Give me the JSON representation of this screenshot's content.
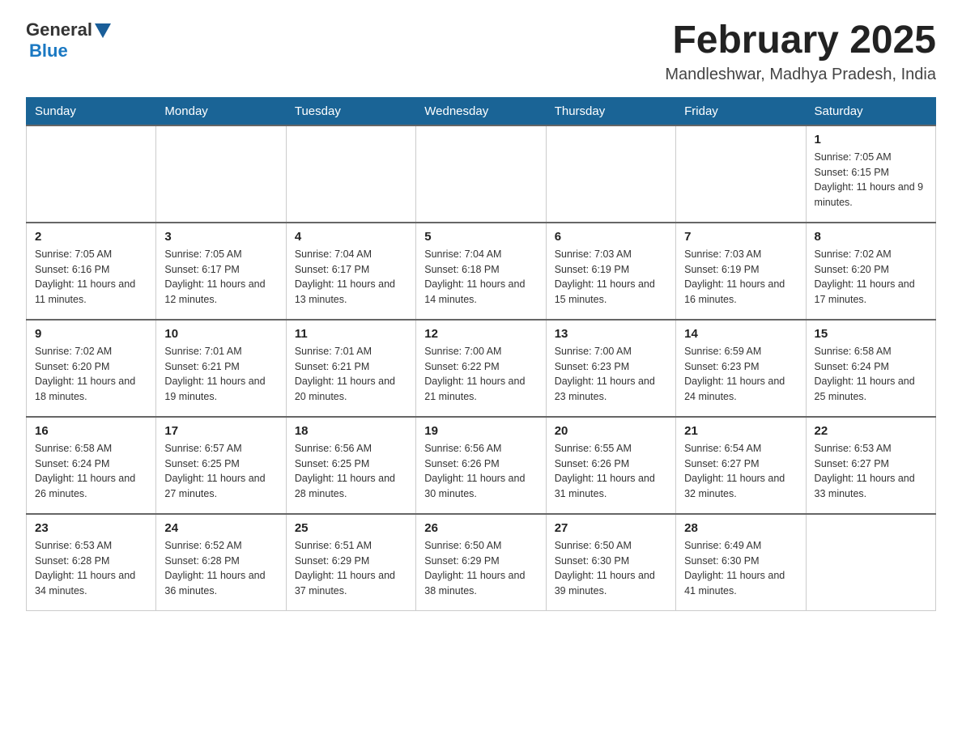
{
  "header": {
    "logo_general": "General",
    "logo_blue": "Blue",
    "month_title": "February 2025",
    "location": "Mandleshwar, Madhya Pradesh, India"
  },
  "weekdays": [
    "Sunday",
    "Monday",
    "Tuesday",
    "Wednesday",
    "Thursday",
    "Friday",
    "Saturday"
  ],
  "weeks": [
    [
      {
        "day": "",
        "info": ""
      },
      {
        "day": "",
        "info": ""
      },
      {
        "day": "",
        "info": ""
      },
      {
        "day": "",
        "info": ""
      },
      {
        "day": "",
        "info": ""
      },
      {
        "day": "",
        "info": ""
      },
      {
        "day": "1",
        "info": "Sunrise: 7:05 AM\nSunset: 6:15 PM\nDaylight: 11 hours and 9 minutes."
      }
    ],
    [
      {
        "day": "2",
        "info": "Sunrise: 7:05 AM\nSunset: 6:16 PM\nDaylight: 11 hours and 11 minutes."
      },
      {
        "day": "3",
        "info": "Sunrise: 7:05 AM\nSunset: 6:17 PM\nDaylight: 11 hours and 12 minutes."
      },
      {
        "day": "4",
        "info": "Sunrise: 7:04 AM\nSunset: 6:17 PM\nDaylight: 11 hours and 13 minutes."
      },
      {
        "day": "5",
        "info": "Sunrise: 7:04 AM\nSunset: 6:18 PM\nDaylight: 11 hours and 14 minutes."
      },
      {
        "day": "6",
        "info": "Sunrise: 7:03 AM\nSunset: 6:19 PM\nDaylight: 11 hours and 15 minutes."
      },
      {
        "day": "7",
        "info": "Sunrise: 7:03 AM\nSunset: 6:19 PM\nDaylight: 11 hours and 16 minutes."
      },
      {
        "day": "8",
        "info": "Sunrise: 7:02 AM\nSunset: 6:20 PM\nDaylight: 11 hours and 17 minutes."
      }
    ],
    [
      {
        "day": "9",
        "info": "Sunrise: 7:02 AM\nSunset: 6:20 PM\nDaylight: 11 hours and 18 minutes."
      },
      {
        "day": "10",
        "info": "Sunrise: 7:01 AM\nSunset: 6:21 PM\nDaylight: 11 hours and 19 minutes."
      },
      {
        "day": "11",
        "info": "Sunrise: 7:01 AM\nSunset: 6:21 PM\nDaylight: 11 hours and 20 minutes."
      },
      {
        "day": "12",
        "info": "Sunrise: 7:00 AM\nSunset: 6:22 PM\nDaylight: 11 hours and 21 minutes."
      },
      {
        "day": "13",
        "info": "Sunrise: 7:00 AM\nSunset: 6:23 PM\nDaylight: 11 hours and 23 minutes."
      },
      {
        "day": "14",
        "info": "Sunrise: 6:59 AM\nSunset: 6:23 PM\nDaylight: 11 hours and 24 minutes."
      },
      {
        "day": "15",
        "info": "Sunrise: 6:58 AM\nSunset: 6:24 PM\nDaylight: 11 hours and 25 minutes."
      }
    ],
    [
      {
        "day": "16",
        "info": "Sunrise: 6:58 AM\nSunset: 6:24 PM\nDaylight: 11 hours and 26 minutes."
      },
      {
        "day": "17",
        "info": "Sunrise: 6:57 AM\nSunset: 6:25 PM\nDaylight: 11 hours and 27 minutes."
      },
      {
        "day": "18",
        "info": "Sunrise: 6:56 AM\nSunset: 6:25 PM\nDaylight: 11 hours and 28 minutes."
      },
      {
        "day": "19",
        "info": "Sunrise: 6:56 AM\nSunset: 6:26 PM\nDaylight: 11 hours and 30 minutes."
      },
      {
        "day": "20",
        "info": "Sunrise: 6:55 AM\nSunset: 6:26 PM\nDaylight: 11 hours and 31 minutes."
      },
      {
        "day": "21",
        "info": "Sunrise: 6:54 AM\nSunset: 6:27 PM\nDaylight: 11 hours and 32 minutes."
      },
      {
        "day": "22",
        "info": "Sunrise: 6:53 AM\nSunset: 6:27 PM\nDaylight: 11 hours and 33 minutes."
      }
    ],
    [
      {
        "day": "23",
        "info": "Sunrise: 6:53 AM\nSunset: 6:28 PM\nDaylight: 11 hours and 34 minutes."
      },
      {
        "day": "24",
        "info": "Sunrise: 6:52 AM\nSunset: 6:28 PM\nDaylight: 11 hours and 36 minutes."
      },
      {
        "day": "25",
        "info": "Sunrise: 6:51 AM\nSunset: 6:29 PM\nDaylight: 11 hours and 37 minutes."
      },
      {
        "day": "26",
        "info": "Sunrise: 6:50 AM\nSunset: 6:29 PM\nDaylight: 11 hours and 38 minutes."
      },
      {
        "day": "27",
        "info": "Sunrise: 6:50 AM\nSunset: 6:30 PM\nDaylight: 11 hours and 39 minutes."
      },
      {
        "day": "28",
        "info": "Sunrise: 6:49 AM\nSunset: 6:30 PM\nDaylight: 11 hours and 41 minutes."
      },
      {
        "day": "",
        "info": ""
      }
    ]
  ]
}
